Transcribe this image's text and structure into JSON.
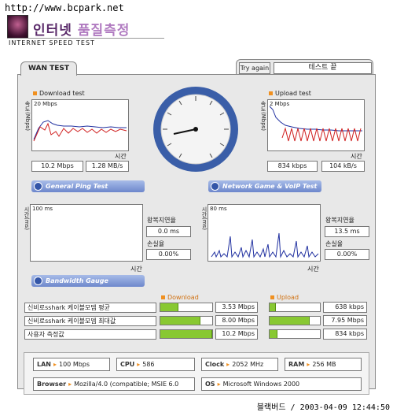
{
  "watermark_url": "http://www.bcpark.net",
  "header": {
    "title_main": "인터넷",
    "title_sub": "품질측정",
    "subtitle": "INTERNET SPEED TEST"
  },
  "tabs": {
    "wan": "WAN TEST"
  },
  "controls": {
    "try_again": "Try again",
    "status": "테스트 끝"
  },
  "download": {
    "title": "Download test",
    "axis_unit": "속도(Mbps)",
    "scale": "20 Mbps",
    "time_label": "시간",
    "speed_mbps": "10.2 Mbps",
    "speed_mbs": "1.28 MB/s"
  },
  "upload": {
    "title": "Upload test",
    "axis_unit": "속도(Mbps)",
    "scale": "2 Mbps",
    "time_label": "시간",
    "speed_kbps": "834 kbps",
    "speed_kbs": "104 kB/s"
  },
  "ping": {
    "banner": "General Ping Test",
    "axis_unit": "시간(ms)",
    "scale": "100 ms",
    "time_label": "시간",
    "rtt_label": "왕복지연율",
    "rtt_value": "0.0 ms",
    "loss_label": "손실율",
    "loss_value": "0.00%"
  },
  "game": {
    "banner": "Network Game & VoIP Test",
    "axis_unit": "시간(ms)",
    "scale": "80 ms",
    "time_label": "시간",
    "rtt_label": "왕복지연율",
    "rtt_value": "13.5 ms",
    "loss_label": "손실율",
    "loss_value": "0.00%"
  },
  "gauge_section": {
    "banner": "Bandwidth Gauge",
    "download_header": "Download",
    "upload_header": "Upload"
  },
  "gauge_rows": [
    {
      "label": "신비로sshark 케이블모뎀 평균",
      "down": "3.53 Mbps",
      "down_fill": 0.35,
      "up": "638 kbps",
      "up_fill": 0.12
    },
    {
      "label": "신비로sshark 케이블모뎀 최대값",
      "down": "8.00 Mbps",
      "down_fill": 0.78,
      "up": "7.95 Mbps",
      "up_fill": 0.8
    },
    {
      "label": "사용자 측정값",
      "down": "10.2 Mbps",
      "down_fill": 1.0,
      "up": "834 kbps",
      "up_fill": 0.15
    }
  ],
  "system": {
    "lan_label": "LAN",
    "lan_value": "100 Mbps",
    "cpu_label": "CPU",
    "cpu_value": "586",
    "clock_label": "Clock",
    "clock_value": "2052 MHz",
    "ram_label": "RAM",
    "ram_value": "256 MB",
    "browser_label": "Browser",
    "browser_value": "Mozilla/4.0 (compatible; MSIE 6.0",
    "os_label": "OS",
    "os_value": "Microsoft Windows 2000"
  },
  "footer": "블랙버드 / 2003-04-09 12:44:50",
  "colors": {
    "accent": "#f09020",
    "bar_green": "#88c832",
    "banner_blue": "#6d87cc",
    "title_purple": "#5a2a6a"
  }
}
